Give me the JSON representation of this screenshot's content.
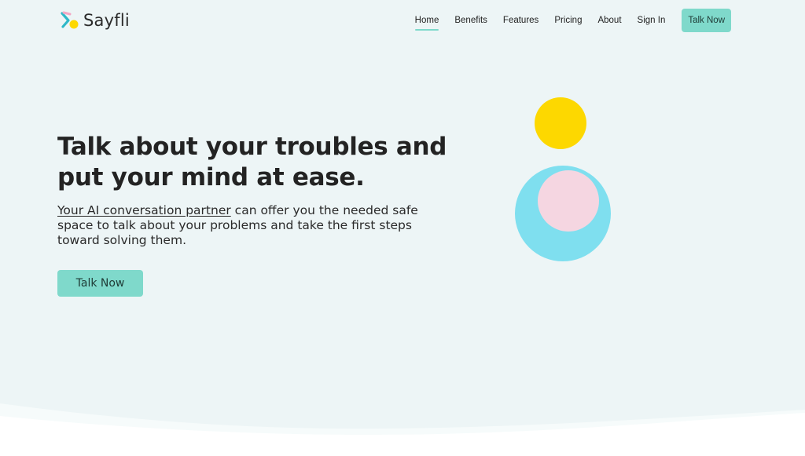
{
  "brand": {
    "name": "Sayfli"
  },
  "nav": {
    "links": [
      {
        "label": "Home",
        "active": true
      },
      {
        "label": "Benefits"
      },
      {
        "label": "Features"
      },
      {
        "label": "Pricing"
      },
      {
        "label": "About"
      },
      {
        "label": "Sign In"
      }
    ],
    "cta": "Talk Now"
  },
  "hero": {
    "title": "Talk about your troubles and put your mind at ease.",
    "link_text": "Your AI conversation partner",
    "body_rest": " can offer you the needed safe space to talk about your problems and take the first steps toward solving them.",
    "cta": "Talk Now"
  },
  "colors": {
    "accent": "#7fd9cb",
    "background": "#edf5f6",
    "yellow": "#fdd800",
    "blue": "#7fdfef",
    "pink": "#f5d6e1"
  }
}
